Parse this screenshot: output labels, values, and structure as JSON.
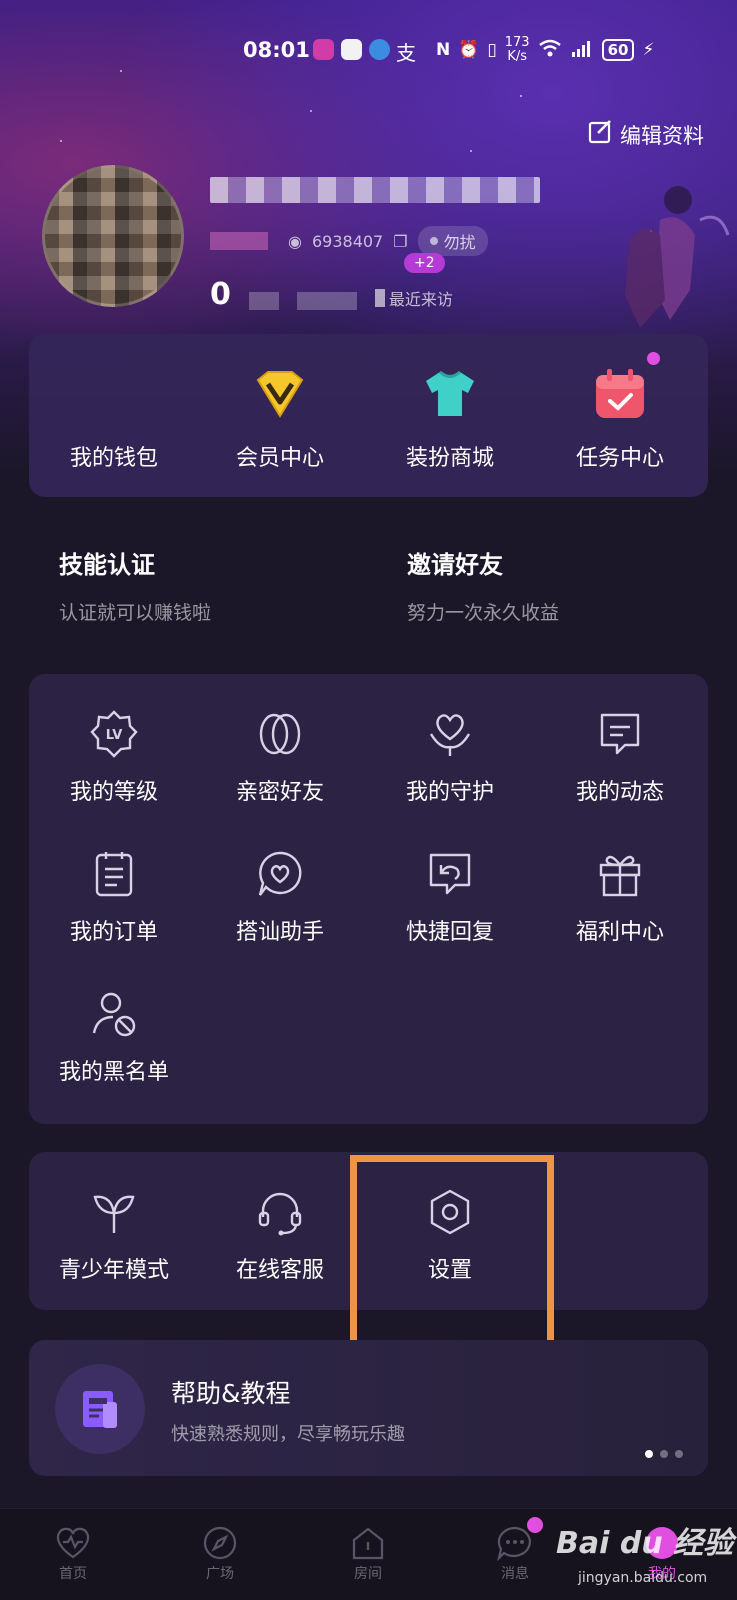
{
  "status_bar": {
    "time": "08:01",
    "speed_top": "173",
    "speed_bottom": "K/s",
    "battery": "60"
  },
  "profile": {
    "edit_label": "编辑资料",
    "id_text": "6938407",
    "dnd_label": "勿扰",
    "stat_count": "0",
    "recent_visit_label": "最近来访",
    "badge": "+2"
  },
  "quick_actions": [
    {
      "label": "我的钱包",
      "icon": "wallet-icon"
    },
    {
      "label": "会员中心",
      "icon": "vip-diamond-icon"
    },
    {
      "label": "装扮商城",
      "icon": "tshirt-icon"
    },
    {
      "label": "任务中心",
      "icon": "calendar-check-icon"
    }
  ],
  "promos": [
    {
      "title": "技能认证",
      "subtitle": "认证就可以赚钱啦"
    },
    {
      "title": "邀请好友",
      "subtitle": "努力一次永久收益"
    }
  ],
  "grid_items": [
    {
      "label": "我的等级",
      "icon": "level-badge-icon"
    },
    {
      "label": "亲密好友",
      "icon": "intimate-friends-icon"
    },
    {
      "label": "我的守护",
      "icon": "guard-heart-icon"
    },
    {
      "label": "我的动态",
      "icon": "moments-icon"
    },
    {
      "label": "我的订单",
      "icon": "order-list-icon"
    },
    {
      "label": "搭讪助手",
      "icon": "chat-heart-icon"
    },
    {
      "label": "快捷回复",
      "icon": "quick-reply-icon"
    },
    {
      "label": "福利中心",
      "icon": "gift-icon"
    },
    {
      "label": "我的黑名单",
      "icon": "blacklist-user-icon"
    }
  ],
  "settings_items": [
    {
      "label": "青少年模式",
      "icon": "sprout-icon"
    },
    {
      "label": "在线客服",
      "icon": "headset-icon"
    },
    {
      "label": "设置",
      "icon": "hexagon-settings-icon"
    }
  ],
  "help": {
    "title": "帮助&教程",
    "subtitle": "快速熟悉规则，尽享畅玩乐趣"
  },
  "bottom_nav": [
    {
      "label": "首页",
      "icon": "heartbeat-icon"
    },
    {
      "label": "广场",
      "icon": "compass-icon"
    },
    {
      "label": "房间",
      "icon": "house-icon"
    },
    {
      "label": "消息",
      "icon": "message-icon"
    },
    {
      "label": "我的",
      "icon": "profile-icon"
    }
  ],
  "watermark": {
    "text": "Bai du 经验",
    "url": "jingyan.baidu.com"
  },
  "colors": {
    "highlight": "#ee9447",
    "card_bg": "#2c2344",
    "accent_badge": "#e04fe0"
  }
}
